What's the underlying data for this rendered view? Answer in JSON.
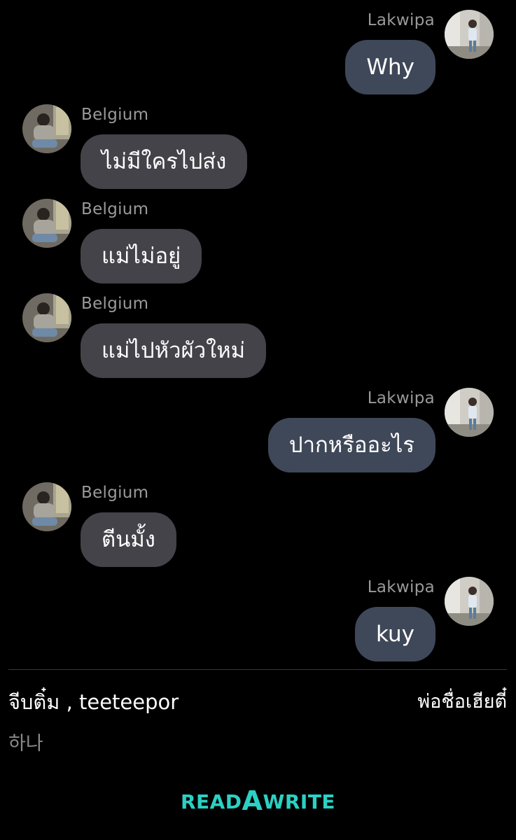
{
  "messages": [
    {
      "side": "right",
      "sender": "Lakwipa",
      "text": "Why"
    },
    {
      "side": "left",
      "sender": "Belgium",
      "text": "ไม่มีใครไปส่ง"
    },
    {
      "side": "left",
      "sender": "Belgium",
      "text": "แม่ไม่อยู่"
    },
    {
      "side": "left",
      "sender": "Belgium",
      "text": "แม่ไปหัวผัวใหม่"
    },
    {
      "side": "right",
      "sender": "Lakwipa",
      "text": "ปากหรืออะไร"
    },
    {
      "side": "left",
      "sender": "Belgium",
      "text": "ตีนมั้ง"
    },
    {
      "side": "right",
      "sender": "Lakwipa",
      "text": "kuy"
    }
  ],
  "footer": {
    "title": "จีบติ๋ม , teeteepor",
    "author": "พ่อชื่อเฮียตี๋",
    "subtitle": "하나"
  },
  "logo": {
    "part1": "READ",
    "part2": "A",
    "part3": "WRITE"
  },
  "colors": {
    "background": "#000000",
    "bubble_left": "#434349",
    "bubble_right": "#3f4858",
    "sender_name": "#9a9a9a",
    "logo": "#2ad1c4"
  },
  "icons": {
    "avatar_left": "belgium-avatar-photo",
    "avatar_right": "lakwipa-avatar-photo"
  }
}
